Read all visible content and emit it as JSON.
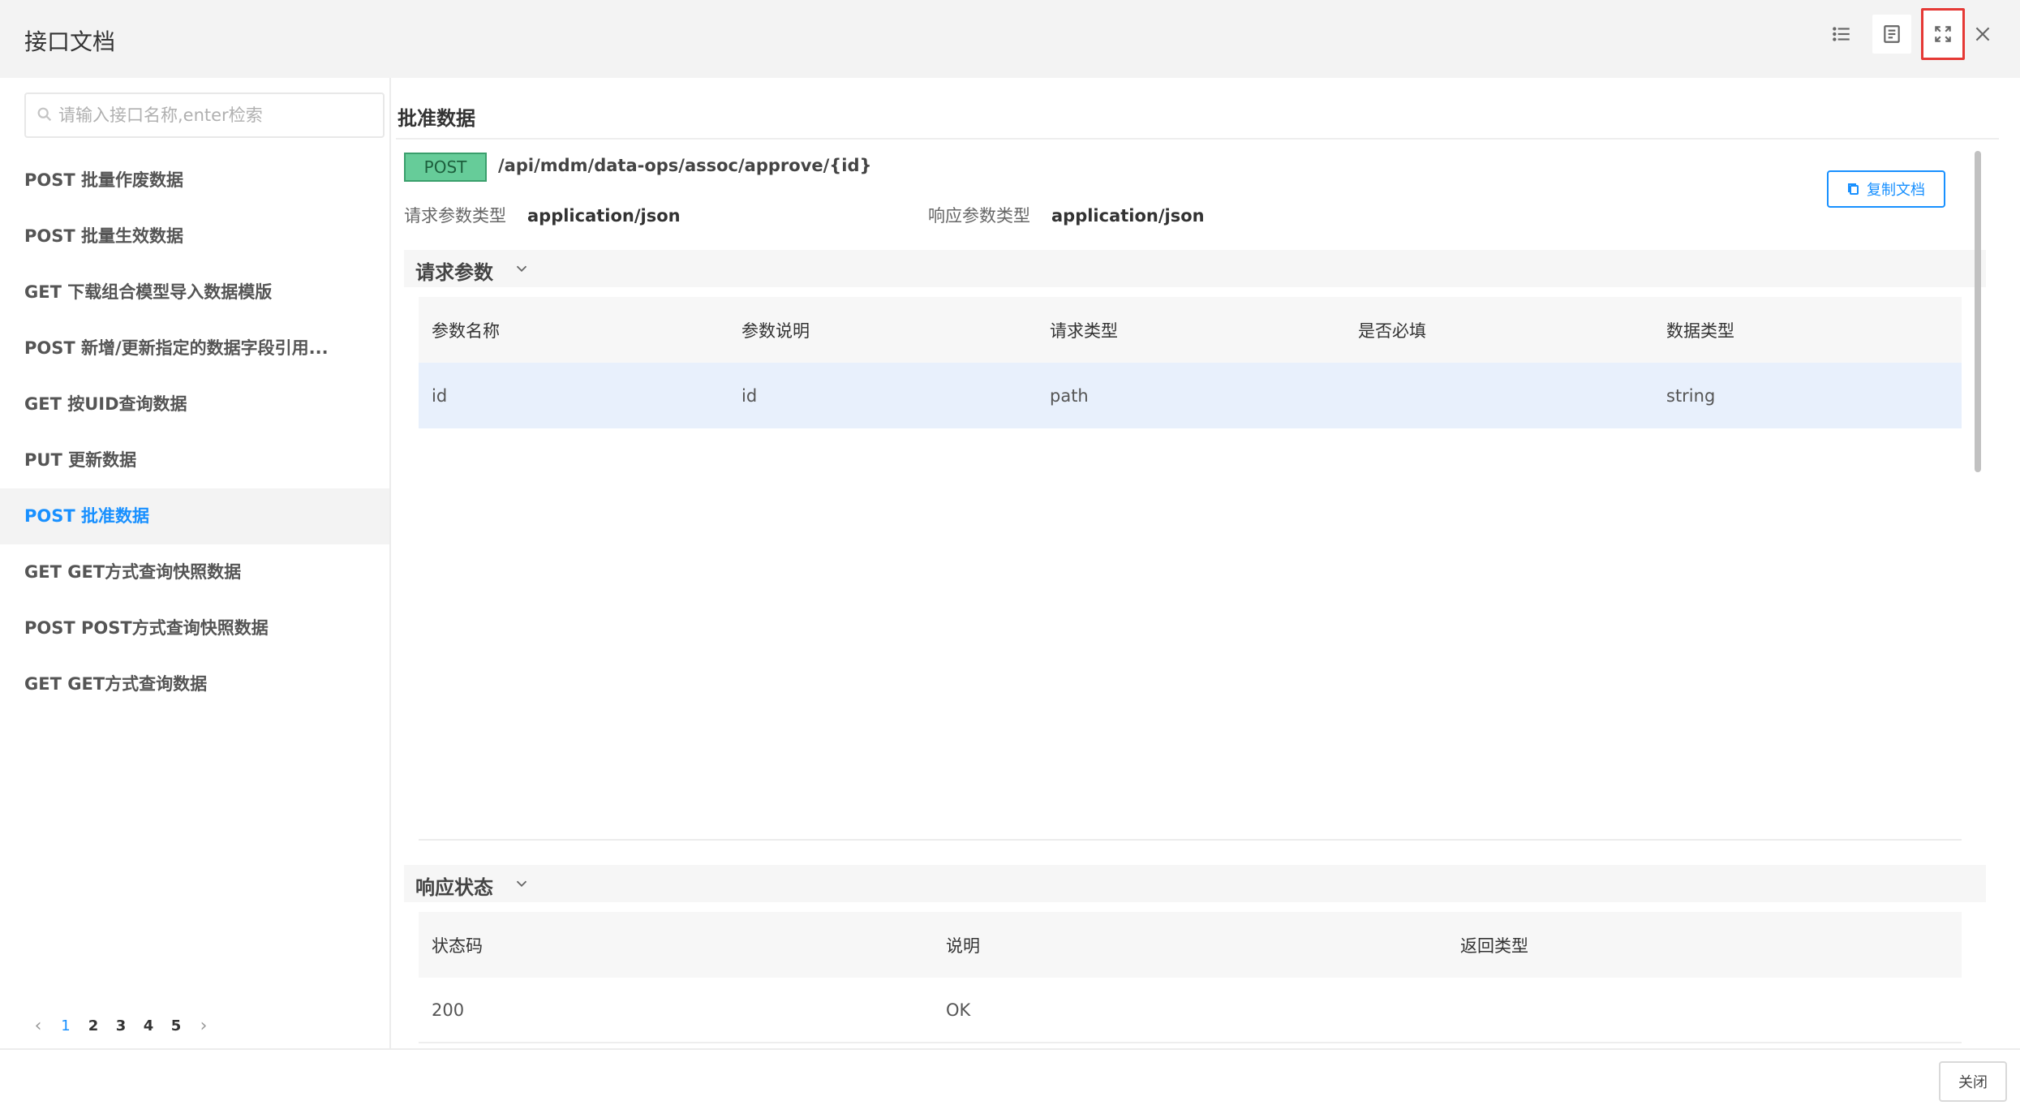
{
  "header": {
    "title": "接口文档"
  },
  "search": {
    "placeholder": "请输入接口名称,enter检索"
  },
  "api_list": [
    {
      "label": "POST 批量作废数据",
      "active": false
    },
    {
      "label": "POST 批量生效数据",
      "active": false
    },
    {
      "label": "GET 下载组合模型导入数据模版",
      "active": false
    },
    {
      "label": "POST 新增/更新指定的数据字段引用...",
      "active": false
    },
    {
      "label": "GET 按UID查询数据",
      "active": false
    },
    {
      "label": "PUT 更新数据",
      "active": false
    },
    {
      "label": "POST 批准数据",
      "active": true
    },
    {
      "label": "GET GET方式查询快照数据",
      "active": false
    },
    {
      "label": "POST POST方式查询快照数据",
      "active": false
    },
    {
      "label": "GET GET方式查询数据",
      "active": false
    }
  ],
  "pagination": {
    "prev": "‹",
    "next": "›",
    "pages": [
      "1",
      "2",
      "3",
      "4",
      "5"
    ],
    "current": "1"
  },
  "detail": {
    "title": "批准数据",
    "method": "POST",
    "path": "/api/mdm/data-ops/assoc/approve/{id}",
    "copy_label": "复制文档",
    "request_type_label": "请求参数类型",
    "request_type_value": "application/json",
    "response_type_label": "响应参数类型",
    "response_type_value": "application/json"
  },
  "request_params": {
    "section_label": "请求参数",
    "columns": [
      "参数名称",
      "参数说明",
      "请求类型",
      "是否必填",
      "数据类型"
    ],
    "rows": [
      [
        "id",
        "id",
        "path",
        "",
        "string"
      ]
    ]
  },
  "response_status": {
    "section_label": "响应状态",
    "columns": [
      "状态码",
      "说明",
      "返回类型"
    ],
    "rows": [
      [
        "200",
        "OK",
        ""
      ]
    ]
  },
  "footer": {
    "close_label": "关闭"
  },
  "colors": {
    "accent": "#1890ff",
    "method_post": "#66cc99",
    "highlight_border": "#e53935"
  }
}
